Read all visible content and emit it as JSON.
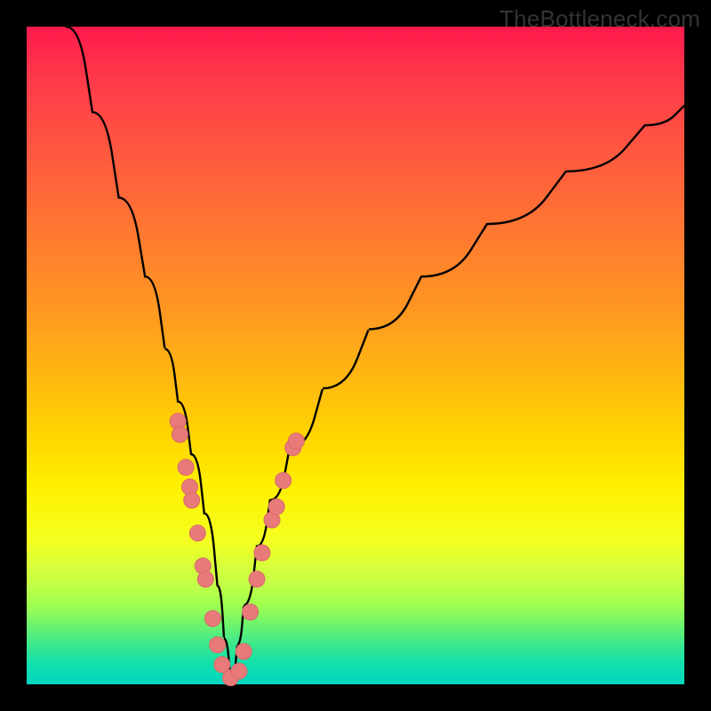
{
  "watermark": "TheBottleneck.com",
  "colors": {
    "frame": "#000000",
    "curve": "#000000",
    "marker_fill": "#e87a7a",
    "marker_stroke": "#d86a6a",
    "gradient_stops": [
      "#ff1a4d",
      "#ff7a30",
      "#ffd400",
      "#fff000",
      "#6cf36e",
      "#00d7c0"
    ]
  },
  "chart_data": {
    "type": "line",
    "title": "",
    "xlabel": "",
    "ylabel": "",
    "xlim": [
      0,
      100
    ],
    "ylim": [
      0,
      100
    ],
    "notch_x": 31,
    "series": [
      {
        "name": "bottleneck-curve",
        "x": [
          6,
          10,
          14,
          18,
          21,
          23,
          25,
          27,
          29,
          30,
          31,
          32,
          33,
          35,
          37,
          40,
          45,
          52,
          60,
          70,
          82,
          94,
          100
        ],
        "values": [
          100,
          87,
          74,
          62,
          51,
          43,
          35,
          26,
          15,
          7,
          0,
          6,
          12,
          21,
          28,
          36,
          45,
          54,
          62,
          70,
          78,
          85,
          88
        ]
      }
    ],
    "markers": {
      "name": "highlighted-points",
      "points": [
        {
          "x": 23.0,
          "y": 40
        },
        {
          "x": 23.3,
          "y": 38
        },
        {
          "x": 24.2,
          "y": 33
        },
        {
          "x": 24.8,
          "y": 30
        },
        {
          "x": 25.1,
          "y": 28
        },
        {
          "x": 26.0,
          "y": 23
        },
        {
          "x": 26.8,
          "y": 18
        },
        {
          "x": 27.2,
          "y": 16
        },
        {
          "x": 28.3,
          "y": 10
        },
        {
          "x": 29.0,
          "y": 6
        },
        {
          "x": 29.7,
          "y": 3
        },
        {
          "x": 31.0,
          "y": 1
        },
        {
          "x": 32.3,
          "y": 2
        },
        {
          "x": 33.0,
          "y": 5
        },
        {
          "x": 34.0,
          "y": 11
        },
        {
          "x": 35.0,
          "y": 16
        },
        {
          "x": 35.8,
          "y": 20
        },
        {
          "x": 37.3,
          "y": 25
        },
        {
          "x": 38.0,
          "y": 27
        },
        {
          "x": 39.0,
          "y": 31
        },
        {
          "x": 40.5,
          "y": 36
        },
        {
          "x": 41.0,
          "y": 37
        }
      ]
    }
  }
}
